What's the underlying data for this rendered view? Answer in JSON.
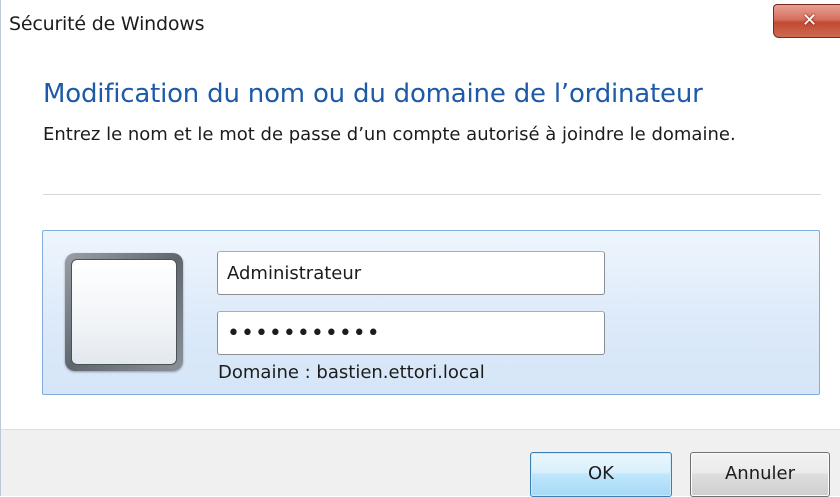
{
  "window": {
    "title": "Sécurité de Windows",
    "close_icon": "close-icon",
    "close_glyph": "✕"
  },
  "dialog": {
    "heading": "Modification du nom ou du domaine de l’ordinateur",
    "instruction": "Entrez le nom et le mot de passe d’un compte autorisé à joindre le domaine."
  },
  "credentials": {
    "user_tile_icon": "user-tile-icon",
    "username_value": "Administrateur",
    "password_value": "•••••••••••",
    "domain_label": "Domaine : bastien.ettori.local"
  },
  "buttons": {
    "ok_label": "OK",
    "cancel_label": "Annuler"
  },
  "colors": {
    "heading": "#1e5aa8",
    "tile_border": "#84acdd",
    "ok_border": "#3c7fb1",
    "close_red": "#c04a33"
  }
}
